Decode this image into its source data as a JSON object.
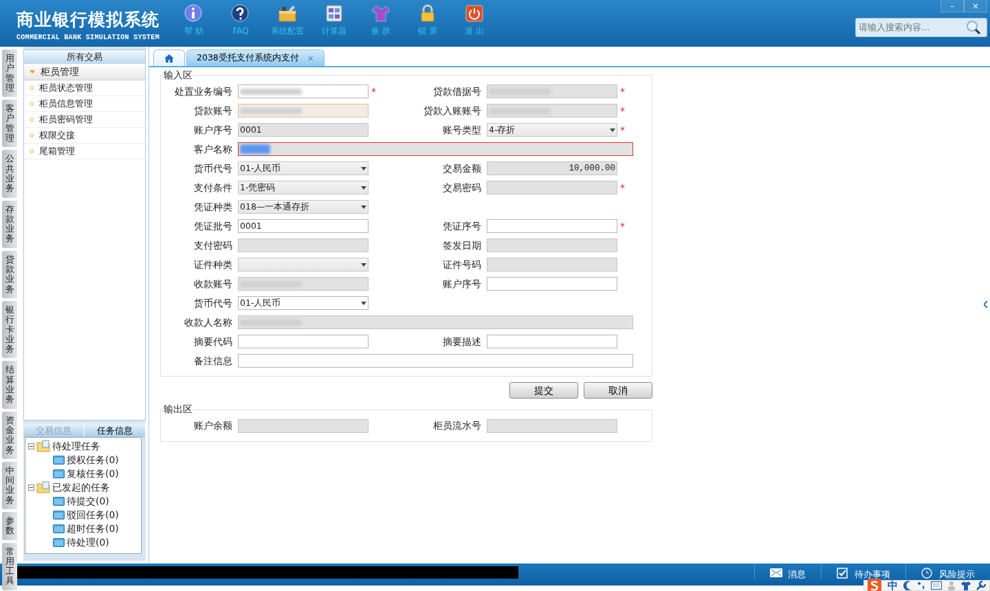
{
  "app": {
    "title": "商业银行模拟系统",
    "subtitle": "COMMERCIAL BANK SIMULATION SYSTEM"
  },
  "toolbar": [
    {
      "label": "帮 助",
      "kind": "info"
    },
    {
      "label": "FAQ",
      "kind": "faq"
    },
    {
      "label": "系统配置",
      "kind": "config"
    },
    {
      "label": "计算器",
      "kind": "calc"
    },
    {
      "label": "换 肤",
      "kind": "skin"
    },
    {
      "label": "锁 屏",
      "kind": "lock"
    },
    {
      "label": "退 出",
      "kind": "exit"
    }
  ],
  "search": {
    "placeholder": "请输入搜索内容..."
  },
  "window_buttons": [
    "–",
    "×"
  ],
  "side_tabs": [
    {
      "label": "用户管理",
      "selected": false
    },
    {
      "label": "客户管理",
      "selected": false
    },
    {
      "label": "公共业务",
      "selected": false
    },
    {
      "label": "存款业务",
      "selected": false
    },
    {
      "label": "贷款业务",
      "selected": false
    },
    {
      "label": "银行卡业务",
      "selected": false
    },
    {
      "label": "结算业务",
      "selected": false
    },
    {
      "label": "资金业务",
      "selected": false
    },
    {
      "label": "中间业务",
      "selected": false
    },
    {
      "label": "参数",
      "selected": false
    },
    {
      "label": "常用工具",
      "selected": false
    }
  ],
  "sidebar": {
    "header": "所有交易",
    "group": {
      "label": "柜员管理",
      "expanded": true,
      "items": [
        "柜员状态管理",
        "柜员信息管理",
        "柜员密码管理",
        "权限交接",
        "尾箱管理"
      ]
    }
  },
  "task_panel": {
    "tabs": [
      {
        "label": "交易信息",
        "selected": false
      },
      {
        "label": "任务信息",
        "selected": true
      }
    ],
    "tree": [
      {
        "label": "待处理任务",
        "expanded": true,
        "children": [
          {
            "label": "授权任务(0)"
          },
          {
            "label": "复核任务(0)"
          }
        ]
      },
      {
        "label": "已发起的任务",
        "expanded": true,
        "children": [
          {
            "label": "待提交(0)"
          },
          {
            "label": "驳回任务(0)"
          },
          {
            "label": "超时任务(0)"
          },
          {
            "label": "待处理(0)"
          }
        ]
      }
    ]
  },
  "doc_tabs": [
    {
      "kind": "home",
      "selected": false
    },
    {
      "kind": "page",
      "label": "2038受托支付系统内支付",
      "selected": true,
      "close_label": "×"
    }
  ],
  "input_section": {
    "title": "输入区",
    "rows": [
      [
        {
          "label": "处置业务编号",
          "kind": "text",
          "disabled": false,
          "blurred": true,
          "required_mark": "*"
        },
        {
          "label": "贷款借据号",
          "kind": "text",
          "disabled": true,
          "blurred": true,
          "required_mark": "*"
        }
      ],
      [
        {
          "label": "贷款账号",
          "kind": "text",
          "disabled": true,
          "blurred": true,
          "warning": true
        },
        {
          "label": "贷款入账账号",
          "kind": "text",
          "disabled": true,
          "blurred": true,
          "required_mark": "*"
        }
      ],
      [
        {
          "label": "账户序号",
          "kind": "text",
          "disabled": true,
          "value": "0001"
        },
        {
          "label": "账号类型",
          "kind": "select",
          "disabled": true,
          "value": "4-存折",
          "required_mark": "*"
        }
      ],
      [
        {
          "label": "客户名称",
          "kind": "text",
          "wide": true,
          "disabled": true,
          "blurred": true,
          "text_selected": true,
          "error": true
        }
      ],
      [
        {
          "label": "货币代号",
          "kind": "select",
          "disabled": true,
          "value": "01-人民币"
        },
        {
          "label": "交易金额",
          "kind": "amount",
          "disabled": true,
          "value": "10,000.00"
        }
      ],
      [
        {
          "label": "支付条件",
          "kind": "select",
          "disabled": true,
          "value": "1-凭密码"
        },
        {
          "label": "交易密码",
          "kind": "text",
          "disabled": true,
          "required_mark": "*"
        }
      ],
      [
        {
          "label": "凭证种类",
          "kind": "select",
          "disabled": true,
          "value": "018—一本通存折"
        }
      ],
      [
        {
          "label": "凭证批号",
          "kind": "text",
          "disabled": false,
          "value": "0001"
        },
        {
          "label": "凭证序号",
          "kind": "text",
          "disabled": false,
          "required_mark": "*"
        }
      ],
      [
        {
          "label": "支付密码",
          "kind": "text",
          "disabled": true
        },
        {
          "label": "签发日期",
          "kind": "text",
          "disabled": true
        }
      ],
      [
        {
          "label": "证件种类",
          "kind": "select",
          "disabled": true
        },
        {
          "label": "证件号码",
          "kind": "text",
          "disabled": true
        }
      ],
      [
        {
          "label": "收款账号",
          "kind": "text",
          "disabled": true,
          "blurred": true
        },
        {
          "label": "账户序号",
          "kind": "text",
          "disabled": false
        }
      ],
      [
        {
          "label": "货币代号",
          "kind": "select",
          "disabled": false,
          "value": "01-人民币"
        }
      ],
      [
        {
          "label": "收款人名称",
          "kind": "text",
          "wide": true,
          "disabled": true,
          "blurred": true
        }
      ],
      [
        {
          "label": "摘要代码",
          "kind": "text",
          "disabled": false
        },
        {
          "label": "摘要描述",
          "kind": "text",
          "disabled": false
        }
      ],
      [
        {
          "label": "备注信息",
          "kind": "text",
          "wide": true,
          "disabled": false
        }
      ]
    ]
  },
  "actions": [
    "提交",
    "取消"
  ],
  "output_section": {
    "title": "输出区",
    "rows": [
      [
        {
          "label": "账户余额",
          "kind": "text",
          "disabled": true
        },
        {
          "label": "柜员流水号",
          "kind": "text",
          "disabled": true
        }
      ]
    ]
  },
  "status_bar": {
    "items": [
      {
        "label": "消息",
        "kind": "mail"
      },
      {
        "label": "待办事项",
        "kind": "todo"
      },
      {
        "label": "风险提示",
        "kind": "risk"
      }
    ]
  },
  "ime_bar": {
    "label": "中"
  }
}
